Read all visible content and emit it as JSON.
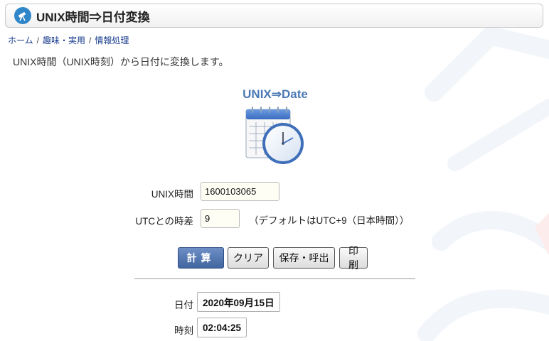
{
  "page": {
    "title": "UNIX時間⇒日付変換",
    "description": "UNIX時間（UNIX時刻）から日付に変換します。"
  },
  "breadcrumb": [
    {
      "label": "ホーム"
    },
    {
      "label": "趣味・実用"
    },
    {
      "label": "情報処理"
    }
  ],
  "breadcrumb_separator": "/",
  "logo": {
    "title": "UNIX⇒Date"
  },
  "form": {
    "unix_time": {
      "label": "UNIX時間",
      "value": "1600103065"
    },
    "utc_offset": {
      "label": "UTCとの時差",
      "value": "9",
      "hint": "（デフォルトはUTC+9（日本時間））"
    }
  },
  "buttons": {
    "calculate": "計算",
    "clear": "クリア",
    "save": "保存・呼出",
    "print": "印刷"
  },
  "result": {
    "date": {
      "label": "日付",
      "value": "2020年09月15日"
    },
    "time": {
      "label": "時刻",
      "value": "02:04:25"
    }
  },
  "colors": {
    "accent": "#4b79b4",
    "primary_button": "#4a6ea8",
    "title_icon": "#2f86c9"
  },
  "icons": {
    "title": "telescope-icon",
    "logo": "calendar-clock-icon"
  }
}
